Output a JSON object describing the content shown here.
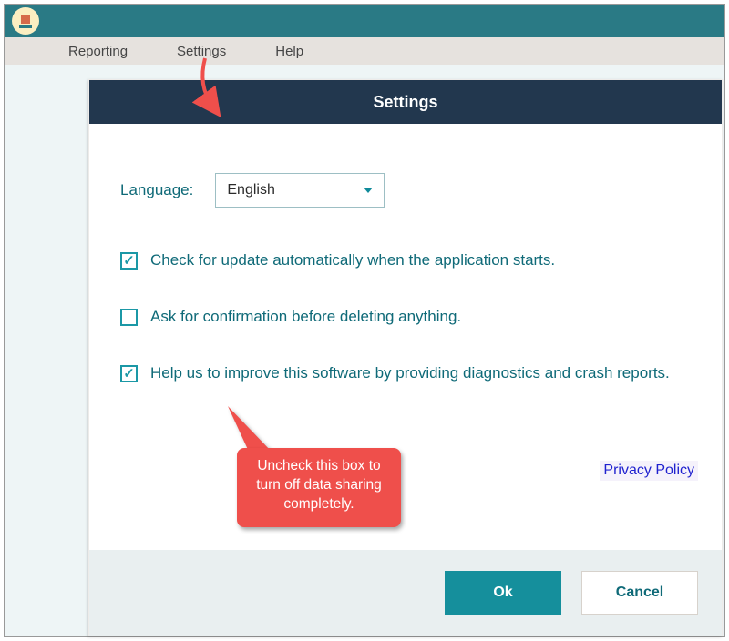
{
  "menu": {
    "reporting": "Reporting",
    "settings": "Settings",
    "help": "Help"
  },
  "dialog": {
    "title": "Settings",
    "language_label": "Language:",
    "language_value": "English",
    "check_update": "Check for update automatically when the application starts.",
    "check_confirm": "Ask for confirmation before deleting anything.",
    "check_diag": "Help us to improve this software by providing diagnostics and crash reports.",
    "privacy": "Privacy Policy",
    "ok": "Ok",
    "cancel": "Cancel"
  },
  "annotation": {
    "callout": "Uncheck this box to turn off data sharing completely."
  }
}
